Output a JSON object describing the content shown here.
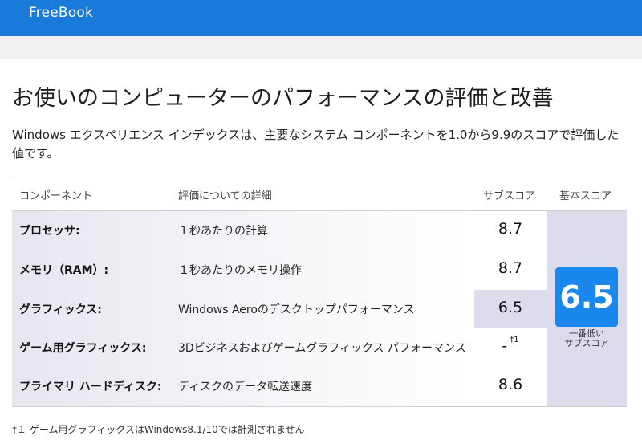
{
  "app": {
    "title": "FreeBook"
  },
  "page": {
    "title": "お使いのコンピューターのパフォーマンスの評価と改善",
    "description": "Windows エクスペリエンス インデックスは、主要なシステム コンポーネントを1.0から9.9のスコアで評価した値です。"
  },
  "table": {
    "headers": {
      "component": "コンポーネント",
      "detail": "評価についての詳細",
      "subscore": "サブスコア",
      "base": "基本スコア"
    },
    "rows": [
      {
        "component": "プロセッサ:",
        "detail": "１秒あたりの計算",
        "subscore": "8.7",
        "footnote_mark": ""
      },
      {
        "component": "メモリ（RAM）:",
        "detail": "１秒あたりのメモリ操作",
        "subscore": "8.7",
        "footnote_mark": ""
      },
      {
        "component": "グラフィックス:",
        "detail": "Windows Aeroのデスクトップパフォーマンス",
        "subscore": "6.5",
        "footnote_mark": ""
      },
      {
        "component": "ゲーム用グラフィックス:",
        "detail": "3Dビジネスおよびゲームグラフィックス パフォーマンス",
        "subscore": "-",
        "footnote_mark": "†1"
      },
      {
        "component": "プライマリ ハードディスク:",
        "detail": "ディスクのデータ転送速度",
        "subscore": "8.6",
        "footnote_mark": ""
      }
    ],
    "base_score": "6.5",
    "base_caption_line1": "一番低い",
    "base_caption_line2": "サブスコア"
  },
  "footnote": "†１ ゲーム用グラフィックスはWindows8.1/10では計測されません",
  "colors": {
    "appbar": "#1a7ad9",
    "badge": "#1a87ee",
    "panel": "#dcdcec"
  }
}
